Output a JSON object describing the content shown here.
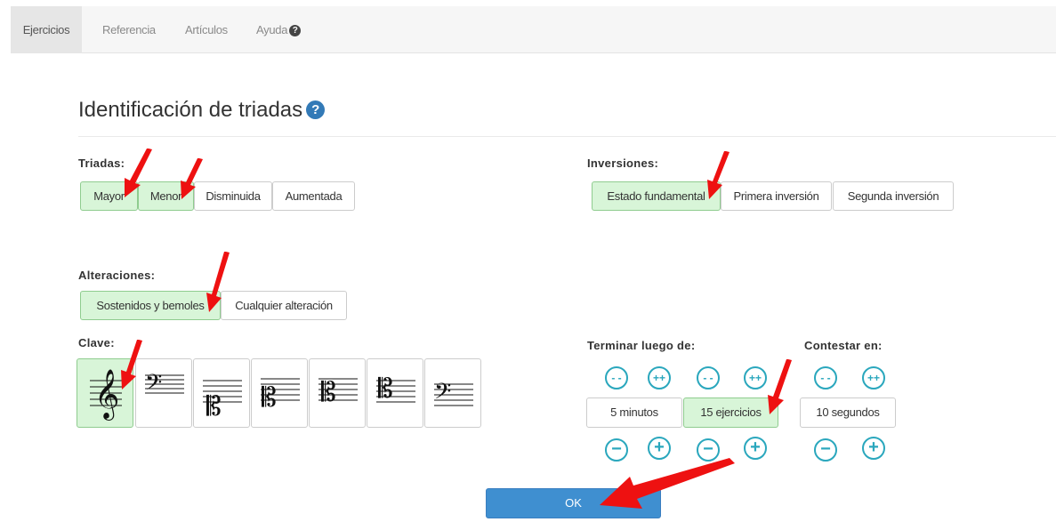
{
  "nav": {
    "tabs": [
      "Ejercicios",
      "Referencia",
      "Artículos",
      "Ayuda"
    ],
    "help_icon": "?"
  },
  "title": "Identificación de triadas",
  "title_help_icon": "?",
  "triadas": {
    "label": "Triadas:",
    "options": [
      "Mayor",
      "Menor",
      "Disminuida",
      "Aumentada"
    ]
  },
  "inversiones": {
    "label": "Inversiones:",
    "options": [
      "Estado fundamental",
      "Primera inversión",
      "Segunda inversión"
    ]
  },
  "alteraciones": {
    "label": "Alteraciones:",
    "options": [
      "Sostenidos y bemoles",
      "Cualquier alteración"
    ]
  },
  "clave": {
    "label": "Clave:",
    "icons": [
      "treble-clef-icon",
      "bass-clef-icon",
      "alto-clef-low-icon",
      "alto-clef-icon",
      "tenor-clef-icon",
      "soprano-clef-icon",
      "baritone-clef-icon"
    ]
  },
  "terminar": {
    "label": "Terminar luego de:",
    "minutes_value": "5 minutos",
    "exercises_value": "15 ejercicios"
  },
  "contestar": {
    "label": "Contestar en:",
    "seconds_value": "10 segundos"
  },
  "controls": {
    "dec_big": "- -",
    "inc_big": "++",
    "dec": "−",
    "inc": "+"
  },
  "ok_label": "OK",
  "selection_colors": {
    "selected_bg": "#d8f5d8",
    "accent": "#3f8fd0",
    "stepper": "#2aa7bd",
    "annotation": "#ee1111"
  }
}
